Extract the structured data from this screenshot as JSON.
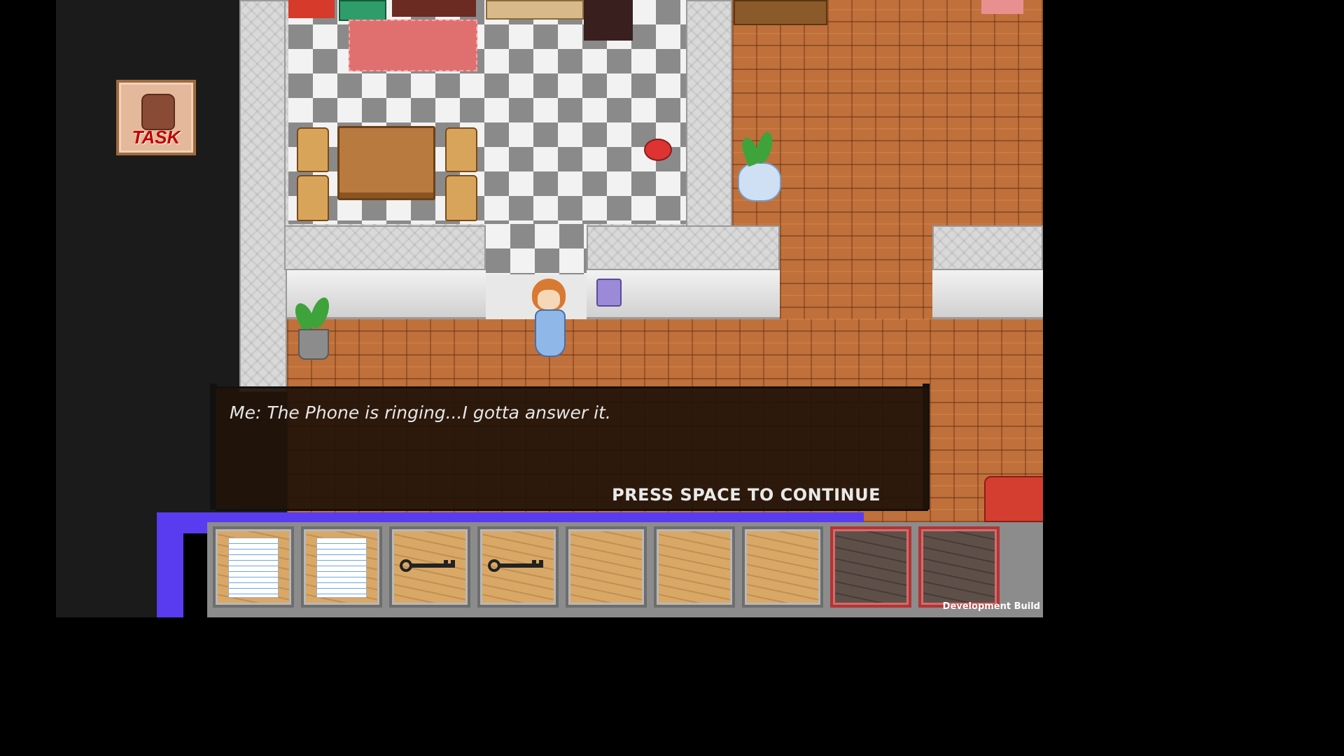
{
  "task": {
    "label": "TASK"
  },
  "dialog": {
    "text": "Me: The Phone is ringing...I gotta answer it.",
    "continue_prompt": "PRESS SPACE TO CONTINUE"
  },
  "hotbar": {
    "slots": [
      {
        "item": "note-icon",
        "state": "filled"
      },
      {
        "item": "note-icon",
        "state": "filled"
      },
      {
        "item": "key-icon",
        "state": "filled"
      },
      {
        "item": "key-icon",
        "state": "filled"
      },
      {
        "item": "",
        "state": "empty"
      },
      {
        "item": "",
        "state": "empty"
      },
      {
        "item": "",
        "state": "empty"
      },
      {
        "item": "",
        "state": "locked"
      },
      {
        "item": "",
        "state": "locked"
      }
    ]
  },
  "footer": {
    "build_label": "Development Build"
  },
  "colors": {
    "task_text": "#c00000",
    "hotbar_accent": "#5a3cf0",
    "locked_slot_border": "#b03535"
  }
}
